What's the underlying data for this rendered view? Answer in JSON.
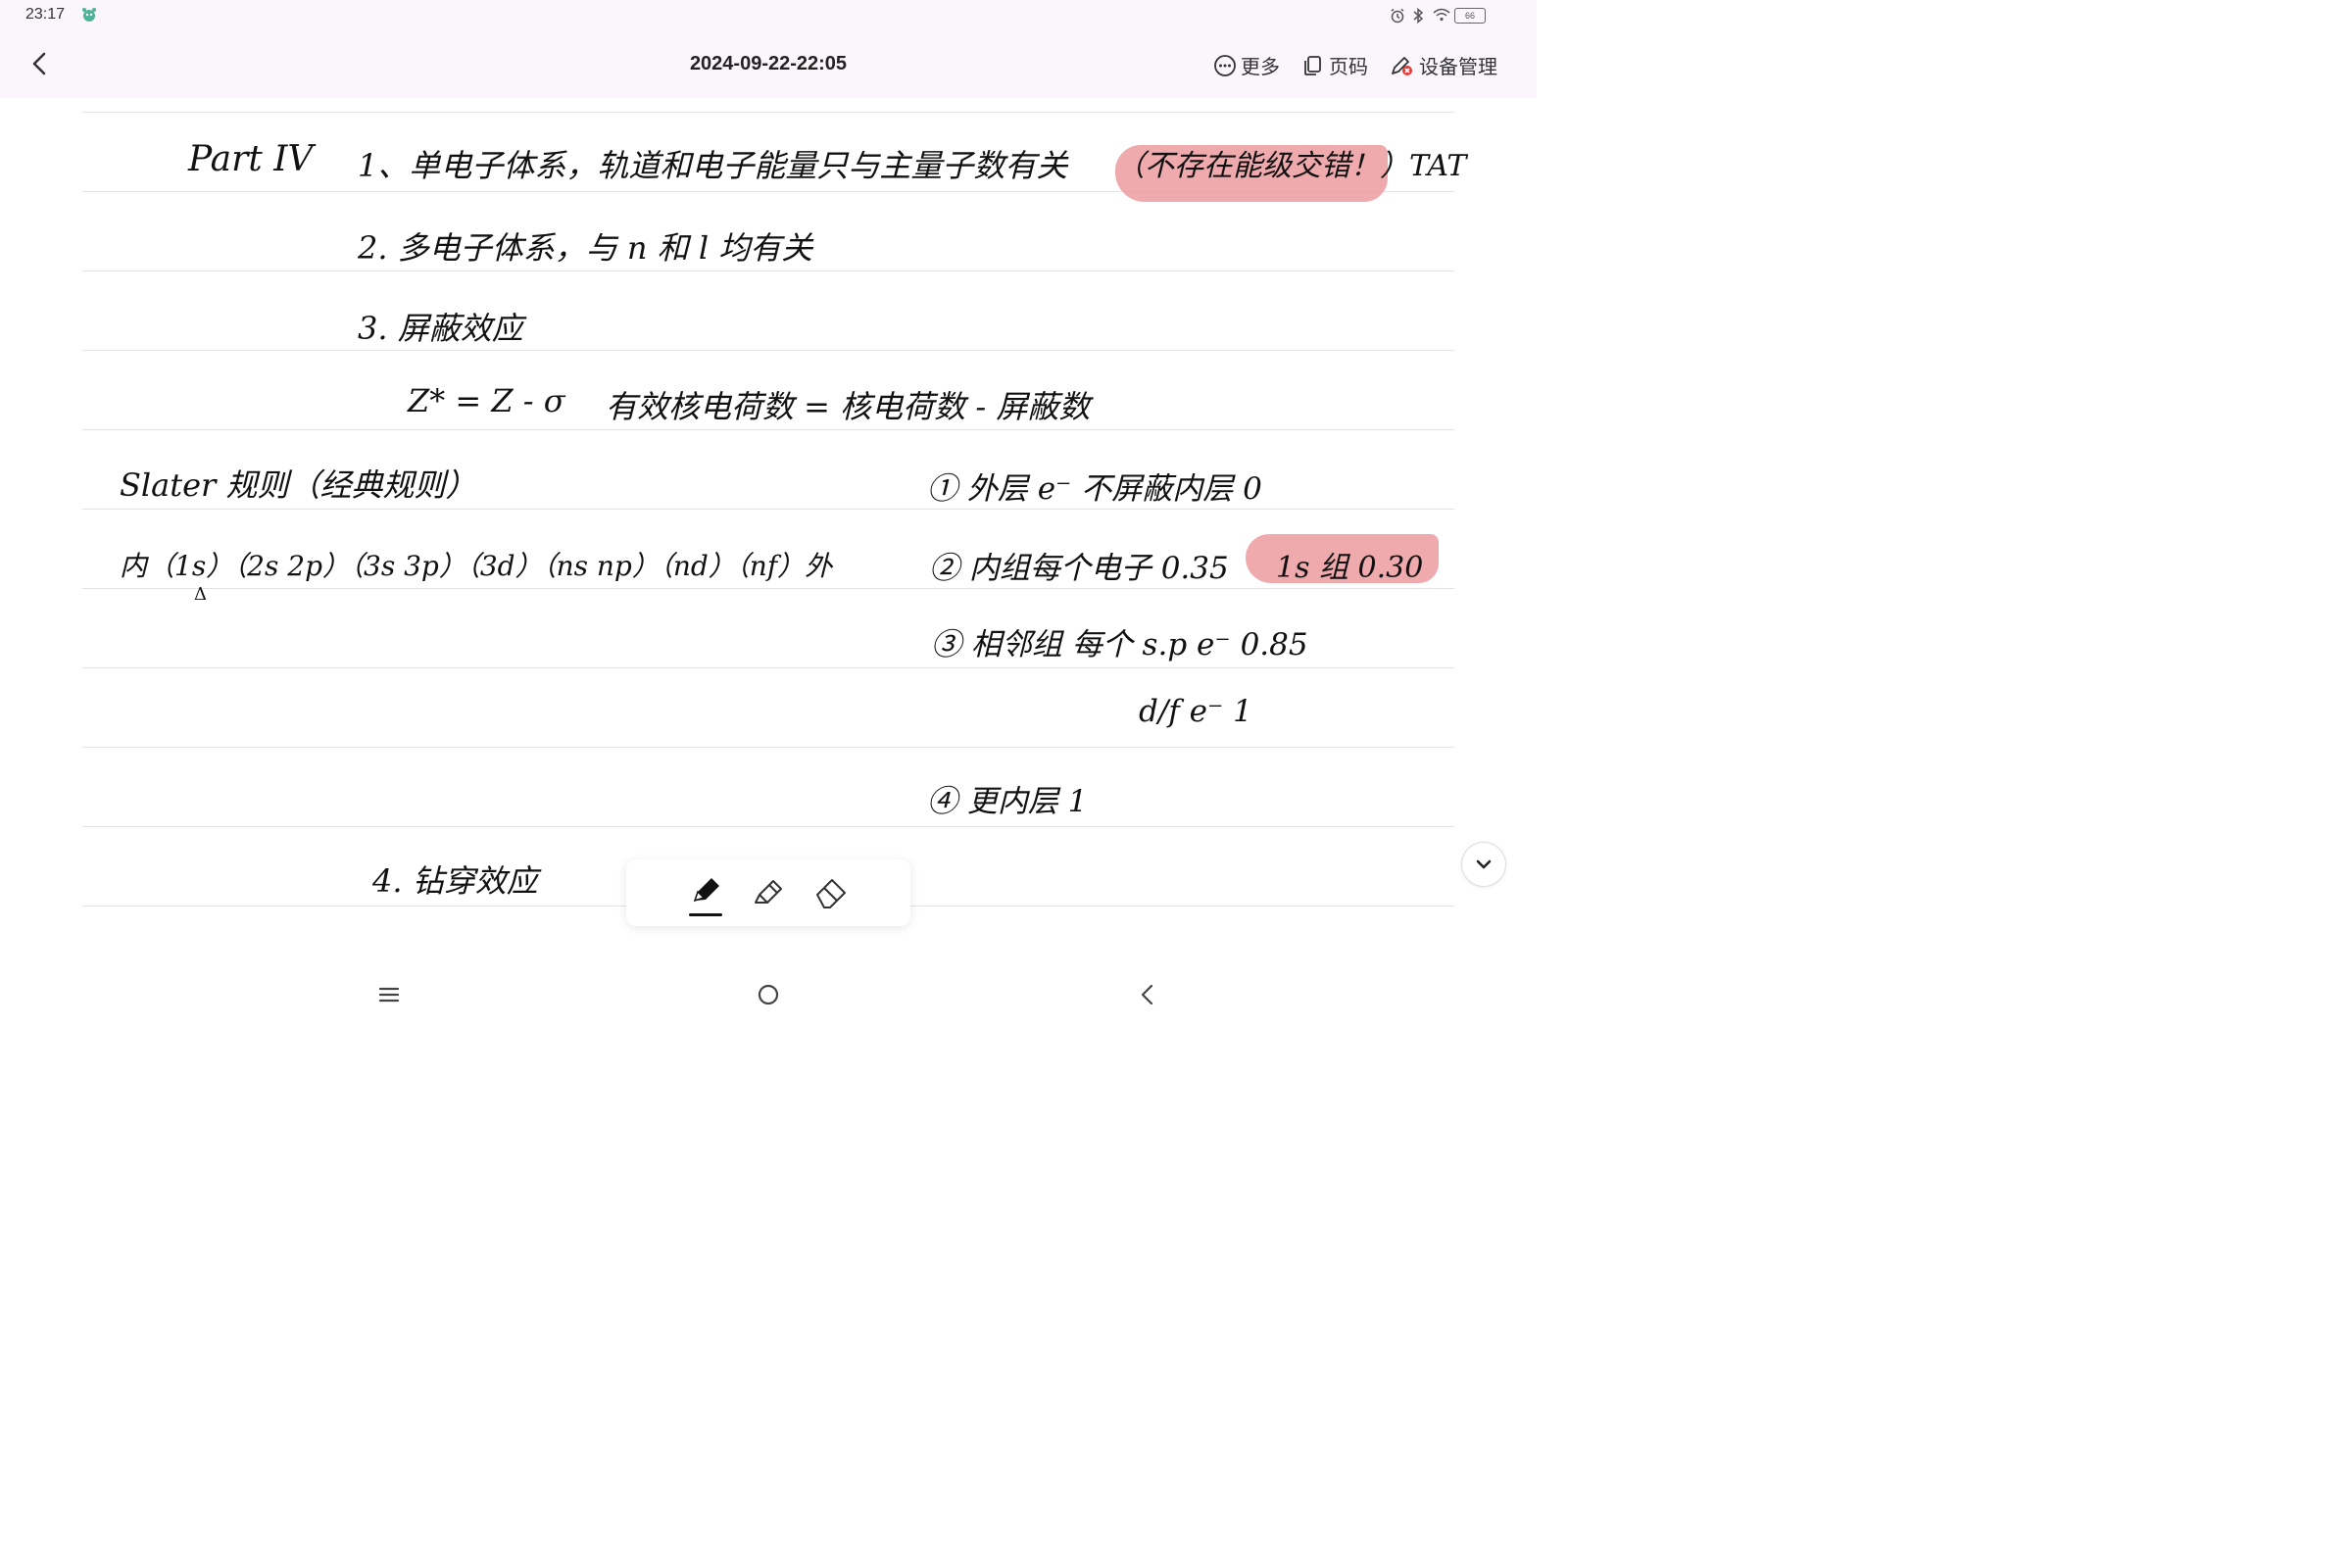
{
  "status": {
    "time": "23:17",
    "battery": "66"
  },
  "header": {
    "title": "2024-09-22-22:05",
    "actions": [
      {
        "label": "更多",
        "icon": "more-circle-icon"
      },
      {
        "label": "页码",
        "icon": "page-copy-icon"
      },
      {
        "label": "设备管理",
        "icon": "device-manage-icon"
      }
    ]
  },
  "note": {
    "part": "Part IV",
    "line1": "1、单电子体系，轨道和电子能量只与主量子数有关",
    "line1_note": "（不存在能级交错！）TAT",
    "line2": "2. 多电子体系，与 n 和 l 均有关",
    "line3": "3. 屏蔽效应",
    "formula": "Z* = Z - σ",
    "formula_text": "有效核电荷数 = 核电荷数 - 屏蔽数",
    "slater": "Slater 规则（经典规则）",
    "order": "内（1s）（2s 2p）（3s 3p）（3d）（ns np）（nd）（nf）外",
    "order_mark": "Δ",
    "rule1": "① 外层 e⁻ 不屏蔽内层 0",
    "rule2": "② 内组每个电子 0.35",
    "rule2_hl": "1s 组 0.30",
    "rule3": "③ 相邻组 每个 s.p e⁻ 0.85",
    "rule3b": "d/f e⁻ 1",
    "rule4": "④ 更内层 1",
    "line4": "4. 钻穿效应"
  },
  "colors": {
    "highlight": "#ec9ba0",
    "header_bg": "#fbf6fb",
    "ink": "#111111"
  }
}
